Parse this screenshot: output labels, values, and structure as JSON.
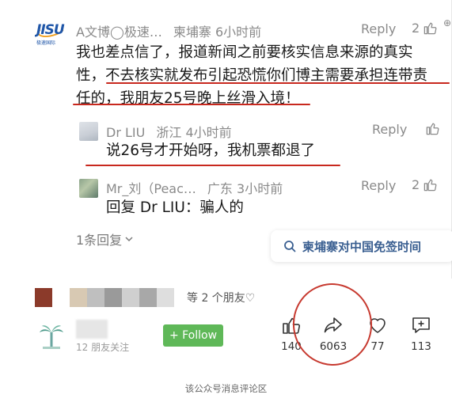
{
  "comment1": {
    "author": "A文博",
    "author_suffix": "◯极速…",
    "location": "柬埔寨",
    "time": "6小时前",
    "reply_label": "Reply",
    "likes": "2",
    "lines": [
      "我也差点信了，报道新闻之前要核实信息来源的真实",
      "性，不去核实就发布引起恐慌你们博主需要承担连带责",
      "任的，我朋友25号晚上丝滑入境！"
    ],
    "avatar_logo": "JISU",
    "avatar_sub": "极速国际"
  },
  "reply1": {
    "author": "Dr LIU",
    "location": "浙江",
    "time": "4小时前",
    "reply_label": "Reply",
    "text": "说26号才开始呀，我机票都退了"
  },
  "reply2": {
    "author": "Mr_刘（Peac…",
    "location": "广东",
    "time": "3小时前",
    "reply_label": "Reply",
    "likes": "2",
    "text": "回复 Dr LIU：骗人的"
  },
  "thread": {
    "replies_count": "1条回复",
    "chevron": "⌄"
  },
  "search_chip": {
    "label": "柬埔寨对中国免签时间"
  },
  "friends": {
    "text": "等 2 个朋友♡"
  },
  "footer": {
    "follower_text": "12  朋友关注",
    "follow_label": "+ Follow",
    "actions": {
      "like": "140",
      "share": "6063",
      "wow": "77",
      "comment": "113"
    }
  },
  "caption": "该公众号消息评论区",
  "colors": {
    "annotation_red": "#c8281e",
    "follow_green": "#5fb858",
    "search_blue": "#3a5f91"
  }
}
